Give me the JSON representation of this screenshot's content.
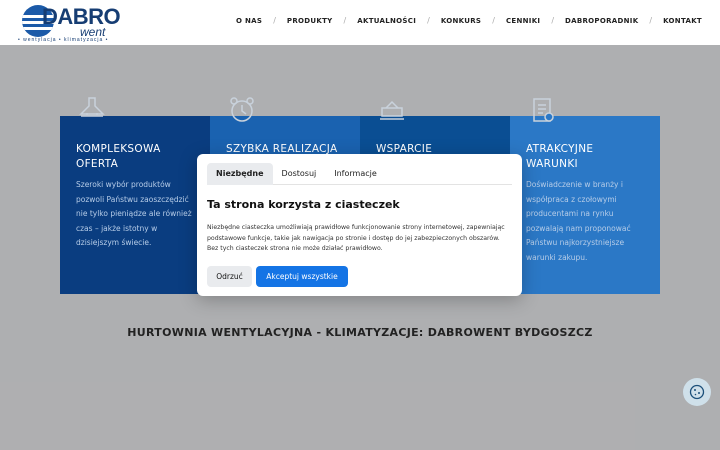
{
  "logo": {
    "brand": "DABRO",
    "sub": "went",
    "tagline": "• wentylacja • klimatyzacja •"
  },
  "nav": {
    "items": [
      "O NAS",
      "PRODUKTY",
      "AKTUALNOŚCI",
      "KONKURS",
      "CENNIKI",
      "DABROPORADNIK",
      "KONTAKT"
    ],
    "separator": "/"
  },
  "features": [
    {
      "title_1": "KOMPLEKSOWA",
      "title_2": "OFERTA",
      "text": "Szeroki wybór produktów pozwoli Państwu zaoszczędzić nie tylko pieniądze ale również czas – jakże istotny w dzisiejszym świecie.",
      "icon": "hood-icon"
    },
    {
      "title_1": "SZYBKA REALIZACJA",
      "title_2": "",
      "text": "",
      "icon": "clock-icon"
    },
    {
      "title_1": "WSPARCIE",
      "title_2": "",
      "text": "",
      "icon": "support-icon"
    },
    {
      "title_1": "ATRAKCYJNE",
      "title_2": "WARUNKI",
      "text": "Doświadczenie w branży i współpraca z czołowymi producentami na rynku pozwalają nam proponować Państwu najkorzystniejsze warunki zakupu.",
      "icon": "price-icon"
    }
  ],
  "section_title": "HURTOWNIA WENTYLACYJNA - KLIMATYZACJE: DABROWENT BYDGOSZCZ",
  "cookie_modal": {
    "tabs": [
      "Niezbędne",
      "Dostosuj",
      "Informacje"
    ],
    "active_tab": "Niezbędne",
    "title": "Ta strona korzysta z ciasteczek",
    "text": "Niezbędne ciasteczka umożliwiają prawidłowe funkcjonowanie strony internetowej, zapewniając podstawowe funkcje, takie jak nawigacja po stronie i dostęp do jej zabezpieczonych obszarów. Bez tych ciasteczek strona nie może działać prawidłowo.",
    "reject_label": "Odrzuć",
    "accept_label": "Akceptuj wszystkie"
  },
  "colors": {
    "brand": "#163d73",
    "accent": "#1474e5"
  }
}
